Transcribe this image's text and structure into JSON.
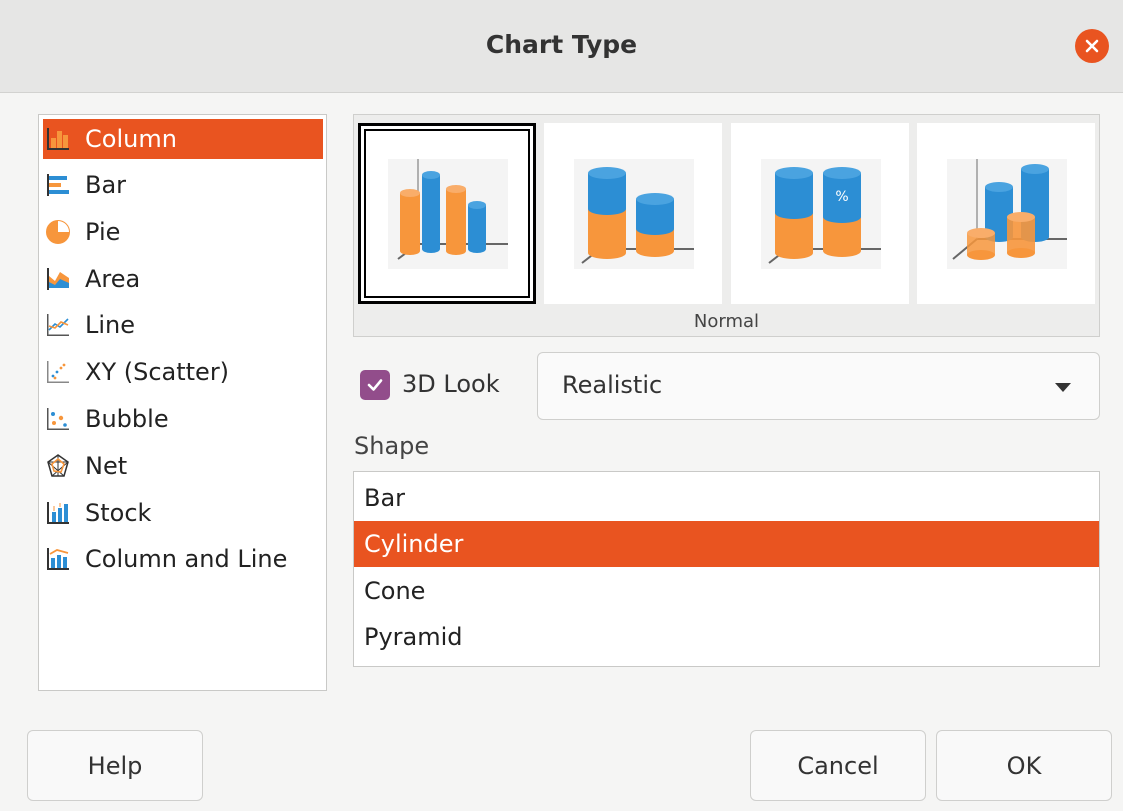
{
  "dialog": {
    "title": "Chart Type"
  },
  "chart_types": [
    {
      "label": "Column",
      "icon": "column-chart-icon",
      "selected": true
    },
    {
      "label": "Bar",
      "icon": "bar-chart-icon",
      "selected": false
    },
    {
      "label": "Pie",
      "icon": "pie-chart-icon",
      "selected": false
    },
    {
      "label": "Area",
      "icon": "area-chart-icon",
      "selected": false
    },
    {
      "label": "Line",
      "icon": "line-chart-icon",
      "selected": false
    },
    {
      "label": "XY (Scatter)",
      "icon": "scatter-chart-icon",
      "selected": false
    },
    {
      "label": "Bubble",
      "icon": "bubble-chart-icon",
      "selected": false
    },
    {
      "label": "Net",
      "icon": "net-chart-icon",
      "selected": false
    },
    {
      "label": "Stock",
      "icon": "stock-chart-icon",
      "selected": false
    },
    {
      "label": "Column and Line",
      "icon": "column-and-line-chart-icon",
      "selected": false
    }
  ],
  "variants": {
    "items": [
      {
        "icon": "cylinder-normal-icon",
        "selected": true
      },
      {
        "icon": "cylinder-stacked-icon",
        "selected": false
      },
      {
        "icon": "cylinder-percent-stacked-icon",
        "selected": false
      },
      {
        "icon": "cylinder-deep-icon",
        "selected": false
      }
    ],
    "label": "Normal",
    "percent_symbol": "%"
  },
  "look3d": {
    "checked": true,
    "label": "3D Look",
    "scheme_value": "Realistic"
  },
  "shape": {
    "heading": "Shape",
    "options": [
      {
        "label": "Bar",
        "selected": false
      },
      {
        "label": "Cylinder",
        "selected": true
      },
      {
        "label": "Cone",
        "selected": false
      },
      {
        "label": "Pyramid",
        "selected": false
      }
    ]
  },
  "buttons": {
    "help": "Help",
    "cancel": "Cancel",
    "ok": "OK"
  },
  "colors": {
    "accent": "#e95420",
    "checkbox": "#924d8b",
    "series_orange": "#f7963c",
    "series_blue": "#2c8ed4"
  }
}
